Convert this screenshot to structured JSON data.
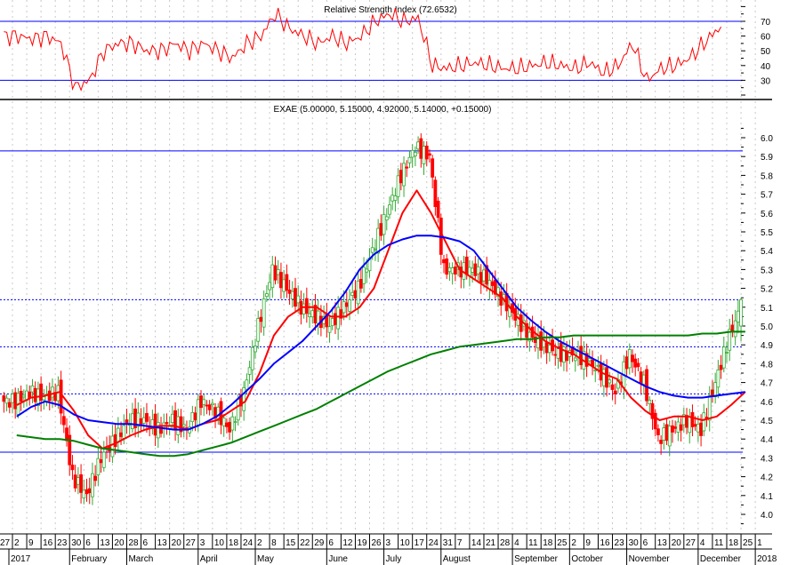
{
  "chart_data": {
    "type": "candlestick",
    "rsi_panel": {
      "title": "Relative Strength Index (72.6532)",
      "ylim": [
        10,
        80
      ],
      "ticks": [
        "70",
        "60",
        "50",
        "40",
        "30"
      ],
      "tick_values": [
        70,
        60,
        50,
        40,
        30
      ],
      "levels": [
        70,
        30
      ],
      "weekly_values": [
        60,
        58,
        60,
        55,
        25,
        30,
        50,
        55,
        55,
        50,
        50,
        55,
        50,
        55,
        50,
        45,
        55,
        60,
        75,
        65,
        60,
        55,
        60,
        55,
        60,
        70,
        75,
        70,
        72,
        40,
        38,
        40,
        42,
        40,
        38,
        38,
        40,
        42,
        40,
        38,
        42,
        35,
        40,
        55,
        30,
        38,
        40,
        45,
        55,
        65,
        72.65
      ],
      "color": "#ff0000"
    },
    "price_panel": {
      "title": "EXAE (5.00000, 5.15000, 4.92000, 5.14000, +0.15000)",
      "ylim": [
        3.9,
        6.1
      ],
      "ticks": [
        "6.0",
        "5.9",
        "5.8",
        "5.7",
        "5.6",
        "5.5",
        "5.4",
        "5.3",
        "5.2",
        "5.1",
        "5.0",
        "4.9",
        "4.8",
        "4.7",
        "4.6",
        "4.5",
        "4.4",
        "4.3",
        "4.2",
        "4.1",
        "4.0"
      ],
      "tick_values": [
        6.0,
        5.9,
        5.8,
        5.7,
        5.6,
        5.5,
        5.4,
        5.3,
        5.2,
        5.1,
        5.0,
        4.9,
        4.8,
        4.7,
        4.6,
        4.5,
        4.4,
        4.3,
        4.2,
        4.1,
        4.0
      ],
      "solid_levels": [
        5.93,
        4.33
      ],
      "dotted_levels": [
        5.14,
        4.89,
        4.64
      ],
      "weekly_closes": [
        4.6,
        4.65,
        4.62,
        4.65,
        4.2,
        4.1,
        4.3,
        4.4,
        4.5,
        4.5,
        4.45,
        4.5,
        4.45,
        4.6,
        4.55,
        4.45,
        4.65,
        5.0,
        5.3,
        5.2,
        5.1,
        5.05,
        5.0,
        5.1,
        5.2,
        5.4,
        5.6,
        5.8,
        5.95,
        5.9,
        5.3,
        5.3,
        5.3,
        5.25,
        5.15,
        5.05,
        4.95,
        4.9,
        4.85,
        4.85,
        4.82,
        4.75,
        4.65,
        4.85,
        4.7,
        4.4,
        4.45,
        4.5,
        4.45,
        4.7,
        4.95,
        5.14
      ],
      "last_bar": {
        "open": 5.0,
        "high": 5.15,
        "low": 4.92,
        "close": 5.14,
        "change": 0.15
      },
      "moving_averages": [
        {
          "name": "short",
          "color": "#ff0000",
          "weekly": [
            4.58,
            4.62,
            4.63,
            4.65,
            4.55,
            4.42,
            4.35,
            4.38,
            4.42,
            4.45,
            4.47,
            4.47,
            4.45,
            4.48,
            4.5,
            4.55,
            4.6,
            4.75,
            4.95,
            5.05,
            5.1,
            5.1,
            5.05,
            5.05,
            5.1,
            5.2,
            5.4,
            5.6,
            5.72,
            5.6,
            5.45,
            5.3,
            5.25,
            5.2,
            5.15,
            5.05,
            4.98,
            4.92,
            4.88,
            4.85,
            4.8,
            4.75,
            4.72,
            4.62,
            4.55,
            4.5,
            4.52,
            4.52,
            4.5,
            4.52,
            4.58,
            4.65
          ]
        },
        {
          "name": "medium",
          "color": "#0000ff",
          "weekly": [
            4.52,
            4.57,
            4.6,
            4.58,
            4.53,
            4.5,
            4.49,
            4.48,
            4.48,
            4.47,
            4.46,
            4.45,
            4.45,
            4.48,
            4.52,
            4.58,
            4.65,
            4.72,
            4.8,
            4.86,
            4.92,
            5.0,
            5.08,
            5.18,
            5.3,
            5.38,
            5.43,
            5.46,
            5.48,
            5.48,
            5.47,
            5.45,
            5.4,
            5.3,
            5.2,
            5.1,
            5.03,
            4.97,
            4.92,
            4.88,
            4.84,
            4.8,
            4.76,
            4.72,
            4.68,
            4.65,
            4.63,
            4.62,
            4.62,
            4.63,
            4.64,
            4.65
          ]
        },
        {
          "name": "long",
          "color": "#008000",
          "weekly": [
            4.42,
            4.41,
            4.4,
            4.4,
            4.39,
            4.37,
            4.35,
            4.34,
            4.33,
            4.32,
            4.31,
            4.31,
            4.32,
            4.34,
            4.36,
            4.38,
            4.41,
            4.44,
            4.47,
            4.5,
            4.53,
            4.56,
            4.6,
            4.64,
            4.68,
            4.72,
            4.76,
            4.79,
            4.82,
            4.85,
            4.87,
            4.89,
            4.9,
            4.91,
            4.92,
            4.93,
            4.93,
            4.94,
            4.94,
            4.95,
            4.95,
            4.95,
            4.95,
            4.95,
            4.95,
            4.95,
            4.95,
            4.95,
            4.96,
            4.96,
            4.97,
            4.97
          ]
        }
      ]
    },
    "x_axis": {
      "day_ticks": [
        "27",
        "2",
        "9",
        "16",
        "23",
        "30",
        "6",
        "13",
        "20",
        "28",
        "6",
        "13",
        "20",
        "27",
        "3",
        "10",
        "18",
        "24",
        "2",
        "8",
        "15",
        "22",
        "29",
        "6",
        "12",
        "19",
        "26",
        "3",
        "10",
        "17",
        "24",
        "31",
        "7",
        "14",
        "21",
        "28",
        "4",
        "11",
        "18",
        "25",
        "2",
        "9",
        "16",
        "23",
        "30",
        "6",
        "13",
        "20",
        "27",
        "4",
        "11",
        "18",
        "25",
        "1"
      ],
      "month_labels": [
        {
          "label": "2017",
          "week": 0
        },
        {
          "label": "February",
          "week": 4
        },
        {
          "label": "March",
          "week": 8
        },
        {
          "label": "April",
          "week": 13
        },
        {
          "label": "May",
          "week": 17
        },
        {
          "label": "June",
          "week": 22
        },
        {
          "label": "July",
          "week": 26
        },
        {
          "label": "August",
          "week": 30
        },
        {
          "label": "September",
          "week": 35
        },
        {
          "label": "October",
          "week": 39
        },
        {
          "label": "November",
          "week": 43
        },
        {
          "label": "December",
          "week": 48
        },
        {
          "label": "2018",
          "week": 52
        }
      ]
    }
  }
}
